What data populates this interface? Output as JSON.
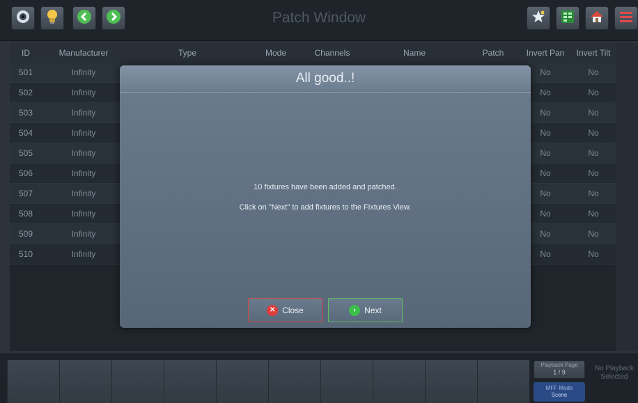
{
  "window": {
    "title": "Patch Window"
  },
  "toolbar": {
    "left_icons": [
      "eye-icon",
      "lightbulb-icon",
      "back-arrow-icon",
      "forward-arrow-icon"
    ],
    "right_icons": [
      "star-icon",
      "grid-icon",
      "home-icon",
      "menu-icon"
    ]
  },
  "table": {
    "headers": [
      "ID",
      "Manufacturer",
      "Type",
      "Mode",
      "Channels",
      "Name",
      "Patch",
      "Invert Pan",
      "Invert Tilt"
    ],
    "rows": [
      {
        "id": "501",
        "manufacturer": "Infinity",
        "invert_pan": "No",
        "invert_tilt": "No"
      },
      {
        "id": "502",
        "manufacturer": "Infinity",
        "invert_pan": "No",
        "invert_tilt": "No"
      },
      {
        "id": "503",
        "manufacturer": "Infinity",
        "invert_pan": "No",
        "invert_tilt": "No"
      },
      {
        "id": "504",
        "manufacturer": "Infinity",
        "invert_pan": "No",
        "invert_tilt": "No"
      },
      {
        "id": "505",
        "manufacturer": "Infinity",
        "invert_pan": "No",
        "invert_tilt": "No"
      },
      {
        "id": "506",
        "manufacturer": "Infinity",
        "invert_pan": "No",
        "invert_tilt": "No"
      },
      {
        "id": "507",
        "manufacturer": "Infinity",
        "invert_pan": "No",
        "invert_tilt": "No"
      },
      {
        "id": "508",
        "manufacturer": "Infinity",
        "invert_pan": "No",
        "invert_tilt": "No"
      },
      {
        "id": "509",
        "manufacturer": "Infinity",
        "invert_pan": "No",
        "invert_tilt": "No"
      },
      {
        "id": "510",
        "manufacturer": "Infinity",
        "invert_pan": "No",
        "invert_tilt": "No"
      }
    ]
  },
  "modal": {
    "title": "All good..!",
    "message_line1": "10 fixtures have been added and patched.",
    "message_line2": "Click on \"Next\" to add fixtures to the Fixtures View.",
    "close_label": "Close",
    "next_label": "Next"
  },
  "bottom_bar": {
    "playback_page_label": "Playback Page",
    "playback_page_value": "1 / 9",
    "mff_mode_label": "MFF Mode",
    "mff_mode_value": "Scene",
    "no_playback_text": "No Playback Selected"
  },
  "colors": {
    "accent_close": "#e03c3c",
    "accent_next": "#3bbf4a",
    "mff_mode_bg": "#2a4a86"
  }
}
